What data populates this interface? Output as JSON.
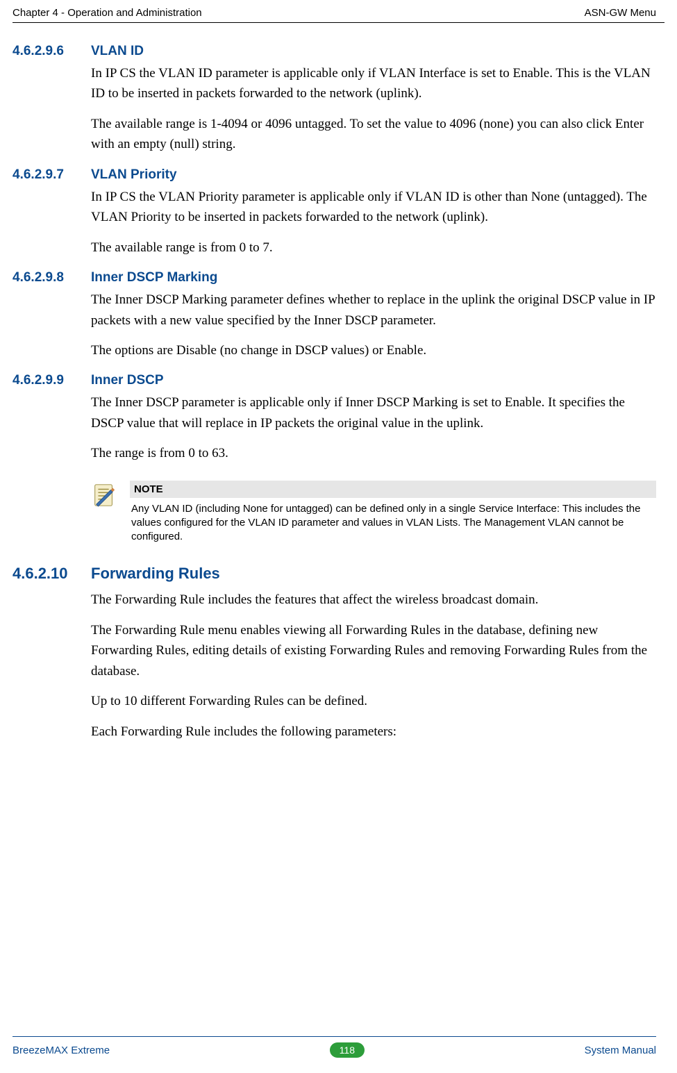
{
  "header": {
    "left": "Chapter 4 - Operation and Administration",
    "right": "ASN-GW Menu"
  },
  "sections": [
    {
      "number": "4.6.2.9.6",
      "title": "VLAN ID",
      "paragraphs": [
        "In IP CS the VLAN ID parameter is applicable only if VLAN Interface is set to Enable. This is the VLAN ID to be inserted in packets forwarded to the network (uplink).",
        "The available range is 1-4094 or 4096 untagged. To set the value to 4096 (none) you can also click Enter with an empty (null) string."
      ]
    },
    {
      "number": "4.6.2.9.7",
      "title": "VLAN Priority",
      "paragraphs": [
        "In IP CS the VLAN Priority parameter is applicable only if VLAN ID is other than None (untagged). The VLAN Priority to be inserted in packets forwarded to the network (uplink).",
        "The available range is from 0 to 7."
      ]
    },
    {
      "number": "4.6.2.9.8",
      "title": "Inner DSCP Marking",
      "paragraphs": [
        "The Inner DSCP Marking parameter defines whether to replace in the uplink the original DSCP value in IP packets with a new value specified by the Inner DSCP parameter.",
        "The options are Disable (no change in DSCP values) or Enable."
      ]
    },
    {
      "number": "4.6.2.9.9",
      "title": "Inner DSCP",
      "paragraphs": [
        "The Inner DSCP parameter is applicable only if Inner DSCP Marking is set to Enable. It specifies the DSCP value that will replace in IP packets the original value in the uplink.",
        "The range is from 0 to 63."
      ]
    }
  ],
  "note": {
    "header": "NOTE",
    "body": "Any VLAN ID (including None for untagged) can be defined only in a single Service Interface: This includes the values configured for the VLAN ID parameter and values in VLAN Lists. The Management VLAN cannot be configured."
  },
  "section_large": {
    "number": "4.6.2.10",
    "title": "Forwarding Rules",
    "paragraphs": [
      "The Forwarding Rule includes the features that affect the wireless broadcast domain.",
      "The Forwarding Rule menu enables viewing all Forwarding Rules in the database, defining new Forwarding Rules, editing details of existing Forwarding Rules and removing Forwarding Rules from the database.",
      "Up to 10 different Forwarding Rules can be defined.",
      "Each Forwarding Rule includes the following parameters:"
    ]
  },
  "footer": {
    "left": "BreezeMAX Extreme",
    "page": "118",
    "right": "System Manual"
  }
}
